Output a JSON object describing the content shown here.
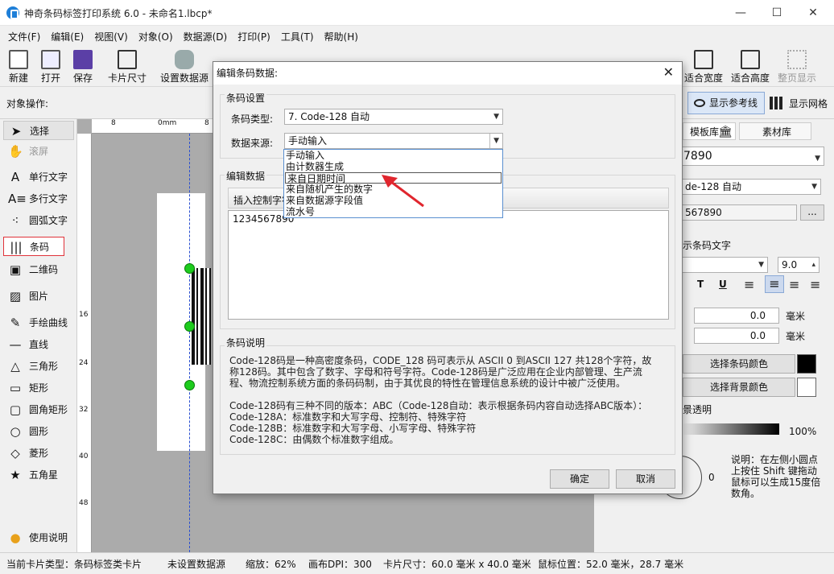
{
  "window": {
    "title": "神奇条码标签打印系统 6.0 - 未命名1.lbcp*"
  },
  "menu": [
    "文件(F)",
    "编辑(E)",
    "视图(V)",
    "对象(O)",
    "数据源(D)",
    "打印(P)",
    "工具(T)",
    "帮助(H)"
  ],
  "toolbar": {
    "new": "新建",
    "open": "打开",
    "save": "保存",
    "card_size": "卡片尺寸",
    "data_source": "设置数据源",
    "fit_width": "适合宽度",
    "fit_height": "适合高度",
    "fit_page": "整页显示"
  },
  "objbar": {
    "label": "对象操作:",
    "ref_line": "显示参考线",
    "grid": "显示网格"
  },
  "tools": [
    "选择",
    "滚屏",
    "单行文字",
    "多行文字",
    "圆弧文字",
    "条码",
    "二维码",
    "图片",
    "手绘曲线",
    "直线",
    "三角形",
    "矩形",
    "圆角矩形",
    "圆形",
    "菱形",
    "五角星",
    "使用说明"
  ],
  "ruler_h": [
    "8",
    "0mm",
    "8"
  ],
  "ruler_v": [
    "16",
    "24",
    "32",
    "40",
    "48"
  ],
  "right": {
    "tab1": "模板库",
    "tab2": "素材库",
    "value": "7890",
    "type": "de-128 自动",
    "code": "567890",
    "show_text": "示条码文字",
    "font_size": "9.0",
    "off1": "0.0",
    "off2": "0.0",
    "unit": "毫米",
    "bar_color": "选择条码颜色",
    "bg_color": "选择背景颜色",
    "transparent": "景透明",
    "pct": "100%",
    "deg": "0",
    "note": "说明：在左侧小圆点上按住 Shift 键拖动鼠标可以生成15度倍数角。"
  },
  "status": {
    "card_type": "当前卡片类型：条码标签类卡片",
    "ds": "未设置数据源",
    "zoom": "缩放：62%",
    "dpi": "画布DPI：300",
    "size": "卡片尺寸：60.0 毫米 x 40.0 毫米",
    "pos": "鼠标位置：52.0 毫米，28.7 毫米"
  },
  "dialog": {
    "title": "编辑条码数据:",
    "grp1": "条码设置",
    "type_label": "条码类型:",
    "type_value": "7. Code-128 自动",
    "src_label": "数据来源:",
    "src_value": "手动输入",
    "options": [
      "手动输入",
      "由计数器生成",
      "来自日期时间",
      "来自随机产生的数字",
      "来自数据源字段值",
      "流水号"
    ],
    "grp2": "编辑数据",
    "insert": "插入控制字符",
    "data_value": "1234567890",
    "grp3": "条码说明",
    "desc": [
      "Code-128码是一种高密度条码，CODE_128 码可表示从 ASCII 0 到ASCII 127 共128个字符，故称128码。其中包含了数字、字母和符号字符。Code-128码是广泛应用在企业内部管理、生产流程、物流控制系统方面的条码码制，由于其优良的特性在管理信息系统的设计中被广泛使用。",
      "Code-128码有三种不同的版本：ABC（Code-128自动：表示根据条码内容自动选择ABC版本）：",
      "Code-128A：标准数字和大写字母、控制符、特殊字符",
      "Code-128B：标准数字和大写字母、小写字母、特殊字符",
      "Code-128C：由偶数个标准数字组成。"
    ],
    "ok": "确定",
    "cancel": "取消"
  }
}
